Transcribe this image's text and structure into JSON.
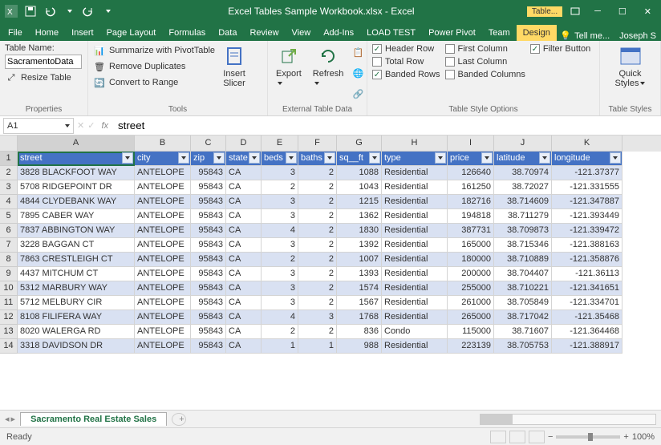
{
  "title": "Excel Tables Sample Workbook.xlsx - Excel",
  "table_tools_label": "Table...",
  "ribbon_tabs": [
    "File",
    "Home",
    "Insert",
    "Page Layout",
    "Formulas",
    "Data",
    "Review",
    "View",
    "Add-Ins",
    "LOAD TEST",
    "Power Pivot",
    "Team",
    "Design"
  ],
  "tell_me": "Tell me...",
  "signin": "Joseph S",
  "properties": {
    "label": "Properties",
    "table_name_label": "Table Name:",
    "table_name_value": "SacramentoData",
    "resize": "Resize Table"
  },
  "tools": {
    "label": "Tools",
    "pivot": "Summarize with PivotTable",
    "dupes": "Remove Duplicates",
    "range": "Convert to Range",
    "slicer": "Insert\nSlicer"
  },
  "external": {
    "label": "External Table Data",
    "export": "Export",
    "refresh": "Refresh"
  },
  "styleopts": {
    "label": "Table Style Options",
    "header_row": "Header Row",
    "total_row": "Total Row",
    "banded_rows": "Banded Rows",
    "first_col": "First Column",
    "last_col": "Last Column",
    "banded_cols": "Banded Columns",
    "filter_btn": "Filter Button"
  },
  "quickstyles": {
    "label": "Table Styles",
    "btn": "Quick\nStyles"
  },
  "namebox": "A1",
  "fx": "fx",
  "formula": "street",
  "cols": [
    "A",
    "B",
    "C",
    "D",
    "E",
    "F",
    "G",
    "H",
    "I",
    "J",
    "K"
  ],
  "headers": [
    "street",
    "city",
    "zip",
    "state",
    "beds",
    "baths",
    "sq__ft",
    "type",
    "price",
    "latitude",
    "longitude"
  ],
  "rows": [
    [
      "3828 BLACKFOOT WAY",
      "ANTELOPE",
      "95843",
      "CA",
      "3",
      "2",
      "1088",
      "Residential",
      "126640",
      "38.70974",
      "-121.37377"
    ],
    [
      "5708 RIDGEPOINT DR",
      "ANTELOPE",
      "95843",
      "CA",
      "2",
      "2",
      "1043",
      "Residential",
      "161250",
      "38.72027",
      "-121.331555"
    ],
    [
      "4844 CLYDEBANK WAY",
      "ANTELOPE",
      "95843",
      "CA",
      "3",
      "2",
      "1215",
      "Residential",
      "182716",
      "38.714609",
      "-121.347887"
    ],
    [
      "7895 CABER WAY",
      "ANTELOPE",
      "95843",
      "CA",
      "3",
      "2",
      "1362",
      "Residential",
      "194818",
      "38.711279",
      "-121.393449"
    ],
    [
      "7837 ABBINGTON WAY",
      "ANTELOPE",
      "95843",
      "CA",
      "4",
      "2",
      "1830",
      "Residential",
      "387731",
      "38.709873",
      "-121.339472"
    ],
    [
      "3228 BAGGAN CT",
      "ANTELOPE",
      "95843",
      "CA",
      "3",
      "2",
      "1392",
      "Residential",
      "165000",
      "38.715346",
      "-121.388163"
    ],
    [
      "7863 CRESTLEIGH CT",
      "ANTELOPE",
      "95843",
      "CA",
      "2",
      "2",
      "1007",
      "Residential",
      "180000",
      "38.710889",
      "-121.358876"
    ],
    [
      "4437 MITCHUM CT",
      "ANTELOPE",
      "95843",
      "CA",
      "3",
      "2",
      "1393",
      "Residential",
      "200000",
      "38.704407",
      "-121.36113"
    ],
    [
      "5312 MARBURY WAY",
      "ANTELOPE",
      "95843",
      "CA",
      "3",
      "2",
      "1574",
      "Residential",
      "255000",
      "38.710221",
      "-121.341651"
    ],
    [
      "5712 MELBURY CIR",
      "ANTELOPE",
      "95843",
      "CA",
      "3",
      "2",
      "1567",
      "Residential",
      "261000",
      "38.705849",
      "-121.334701"
    ],
    [
      "8108 FILIFERA WAY",
      "ANTELOPE",
      "95843",
      "CA",
      "4",
      "3",
      "1768",
      "Residential",
      "265000",
      "38.717042",
      "-121.35468"
    ],
    [
      "8020 WALERGA RD",
      "ANTELOPE",
      "95843",
      "CA",
      "2",
      "2",
      "836",
      "Condo",
      "115000",
      "38.71607",
      "-121.364468"
    ],
    [
      "3318 DAVIDSON DR",
      "ANTELOPE",
      "95843",
      "CA",
      "1",
      "1",
      "988",
      "Residential",
      "223139",
      "38.705753",
      "-121.388917"
    ]
  ],
  "sheet_tab": "Sacramento Real Estate Sales",
  "status": "Ready",
  "zoom": "100%"
}
